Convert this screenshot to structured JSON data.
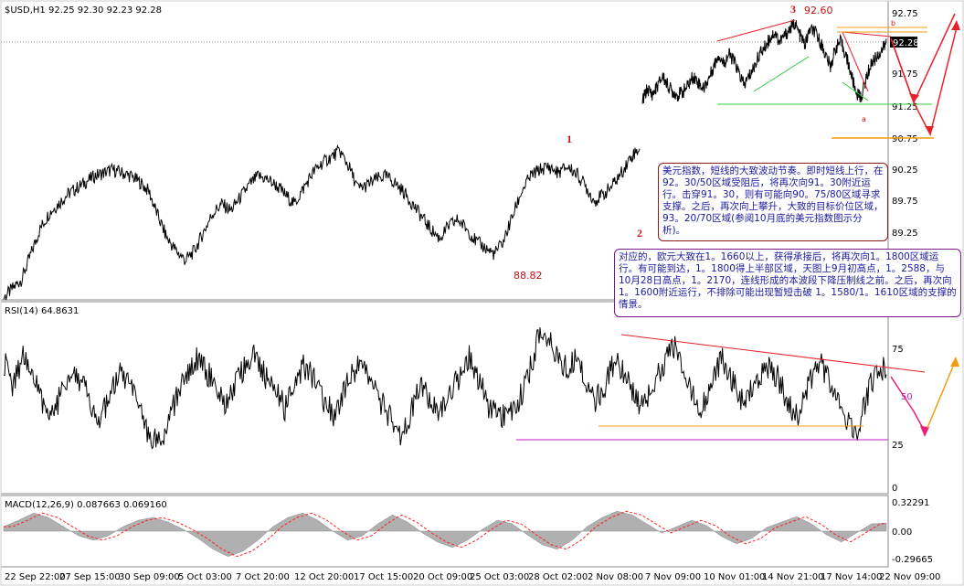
{
  "chart_data": {
    "type": "line",
    "price_panel": {
      "header": "$USD,H1  92.25 92.30 92.23 92.28",
      "y_ticks": [
        "92.75",
        "92.28",
        "91.75",
        "91.25",
        "90.75",
        "90.25",
        "89.75",
        "89.25"
      ],
      "current_price": "92.28",
      "labels": {
        "wave1": "1",
        "wave2": "2",
        "wave3": "3",
        "high": "92.60",
        "low": "88.82",
        "sub_a": "a",
        "sub_b": "b"
      },
      "series": [
        {
          "values": [
            88.2,
            88.35,
            88.5,
            88.9,
            89.3,
            89.55,
            89.7,
            89.85,
            89.95,
            90.05,
            90.15,
            90.2,
            90.25,
            90.2,
            90.15,
            90.05,
            89.9,
            89.5,
            89.15,
            88.95,
            88.8,
            88.95,
            89.25,
            89.55,
            89.7,
            89.6,
            89.8,
            90.0,
            90.15,
            90.1,
            90.0,
            89.85,
            89.7,
            89.95,
            90.2,
            90.35,
            90.45,
            90.55,
            90.3,
            89.95,
            90.0,
            90.1,
            90.15,
            90.05,
            89.9,
            89.7,
            89.5,
            89.3,
            89.15,
            89.35,
            89.45,
            89.3,
            89.1,
            89.0,
            88.9,
            89.1,
            89.5,
            89.9,
            90.15,
            90.25,
            90.3,
            90.2,
            90.3,
            90.2,
            90.0,
            89.75,
            89.85,
            90.0,
            90.2,
            90.45,
            90.6
          ]
        },
        {
          "values": [
            91.35,
            91.55,
            91.45,
            91.6,
            91.75,
            91.6,
            91.5,
            91.45,
            91.5,
            91.6,
            91.75,
            91.65,
            91.55,
            91.7,
            91.9,
            92.1,
            91.95,
            92.1,
            92.0,
            91.8,
            91.6,
            91.75,
            91.9,
            92.1,
            92.2,
            92.35,
            92.45,
            92.3,
            92.4,
            92.5,
            92.6,
            92.4,
            92.25,
            92.5,
            92.45,
            92.3,
            92.1,
            91.9,
            92.2,
            92.3,
            92.1,
            91.8,
            91.5,
            91.4,
            91.7,
            91.95,
            92.05,
            92.15,
            92.28
          ]
        }
      ]
    },
    "rsi_panel": {
      "header": "RSI(14)  64.8631",
      "y_ticks": [
        "75",
        "50",
        "25",
        "0"
      ],
      "side_label": "50",
      "values": [
        68,
        55,
        72,
        60,
        48,
        40,
        52,
        65,
        58,
        45,
        38,
        50,
        62,
        55,
        42,
        30,
        25,
        38,
        52,
        60,
        70,
        62,
        55,
        45,
        58,
        68,
        72,
        60,
        52,
        44,
        55,
        66,
        58,
        48,
        40,
        52,
        62,
        70,
        58,
        46,
        38,
        30,
        42,
        55,
        48,
        40,
        52,
        60,
        72,
        58,
        45,
        40,
        38,
        46,
        60,
        78,
        82,
        72,
        65,
        70,
        60,
        48,
        55,
        70,
        62,
        50,
        45,
        58,
        66,
        78,
        62,
        50,
        44,
        56,
        70,
        60,
        48,
        52,
        60,
        65,
        58,
        45,
        40,
        55,
        68,
        60,
        48,
        38,
        32,
        50,
        64,
        66
      ]
    },
    "macd_panel": {
      "header": "MACD(12,26,9)  0.087663  0.069160",
      "y_ticks": [
        "0.32291",
        "0.00",
        "-0.29665"
      ],
      "histogram": [
        0.05,
        0.12,
        0.2,
        0.15,
        0.05,
        -0.05,
        -0.1,
        -0.05,
        0.05,
        0.12,
        0.15,
        0.1,
        0.02,
        -0.08,
        -0.2,
        -0.28,
        -0.22,
        -0.1,
        0.05,
        0.15,
        0.2,
        0.12,
        0.0,
        -0.1,
        -0.05,
        0.08,
        0.18,
        0.1,
        -0.02,
        -0.12,
        -0.18,
        -0.1,
        0.02,
        0.12,
        0.08,
        -0.04,
        -0.15,
        -0.2,
        -0.1,
        0.05,
        0.15,
        0.22,
        0.18,
        0.08,
        -0.02,
        0.05,
        0.12,
        0.06,
        -0.06,
        -0.14,
        -0.08,
        0.04,
        0.1,
        0.16,
        0.08,
        -0.04,
        -0.12,
        -0.02,
        0.08,
        0.09
      ]
    },
    "x_ticks": [
      "22 Sep 22:00",
      "27 Sep 15:00",
      "30 Sep 09:00",
      "5 Oct 03:00",
      "7 Oct 20:00",
      "12 Oct 20:00",
      "17 Oct 15:00",
      "20 Oct 09:00",
      "25 Oct 03:00",
      "28 Oct 02:00",
      "2 Nov 08:00",
      "7 Nov 09:00",
      "10 Nov 01:00",
      "14 Nov 21:00",
      "17 Nov 14:00",
      "22 Nov 09:00"
    ]
  },
  "annotations": {
    "usd": "美元指数，短线的大致波动节奏。即时短线上行，在92。30/50区域受阻后，将再次向91。30附近运行。击穿91。30，则有可能向90。75/80区域寻求支撑。之后，再次向上攀升，大致的目标价位区域，93。20/70区域(参阅10月底的美元指数图示分析)。",
    "eur": "对应的，欧元大致在1。1660以上，获得承接后，将再次向1。1800区域运行。有可能到达，1。1800得上半部区域，天图上9月初高点，1。2588，与10月28日高点，1。2170，连线形成的本波段下降压制线之前。之后，再次向1。1600附近运行，不排除可能出现暂短击破 1。1580/1。1610区域的支撑的情景。"
  },
  "colors": {
    "price_line": "#000000",
    "trend_red": "#e8202a",
    "trend_green": "#2ecc40",
    "support_orange": "#f39c12",
    "rsi_support_magenta": "#c71ec7",
    "projection_pink": "#e8207a",
    "projection_orange": "#f39c12",
    "label_red": "#cc1111",
    "macd_hist": "#b0b0b0",
    "macd_signal": "#ff2020"
  }
}
